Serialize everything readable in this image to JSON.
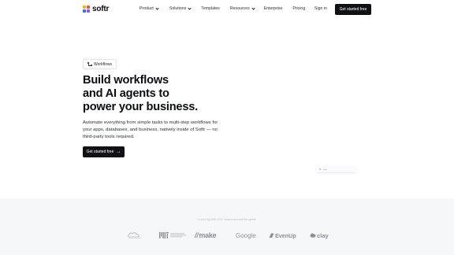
{
  "nav": {
    "brand": "softr",
    "menu": [
      {
        "label": "Product",
        "has_dropdown": true
      },
      {
        "label": "Solutions",
        "has_dropdown": true
      },
      {
        "label": "Templates",
        "has_dropdown": false
      },
      {
        "label": "Resources",
        "has_dropdown": true
      },
      {
        "label": "Enterprise",
        "has_dropdown": false
      },
      {
        "label": "Pricing",
        "has_dropdown": false
      }
    ],
    "sign_in": "Sign in",
    "cta": "Get started free"
  },
  "hero": {
    "badge": "Workflows",
    "headline": [
      "Build workflows",
      "and AI agents to",
      "power your business."
    ],
    "subtitle": "Automate everything from simple tasks to multi-step workflows for your apps, databases, and business, natively inside of Softr — no third-party tools required.",
    "cta": "Get started free",
    "cta_icon": "arrow-right-icon"
  },
  "trust": {
    "text": "Loved by 800,000+ teams around the globe",
    "logos": [
      "salesforce",
      "MIT",
      "make",
      "Google",
      "EvenUp",
      "clay"
    ]
  },
  "colors": {
    "primary_button": "#0f1115",
    "background": "#ffffff",
    "trust_strip": "#f6f7f9",
    "logo_gray": "#8a8e96"
  }
}
